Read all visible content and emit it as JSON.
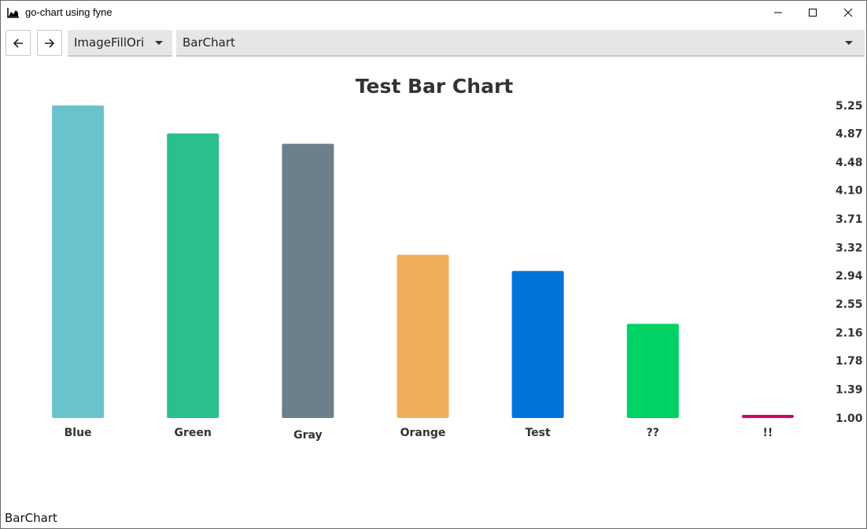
{
  "window": {
    "title": "go-chart using fyne",
    "icon": "area-chart-icon"
  },
  "toolbar": {
    "back_icon": "arrow-left-icon",
    "forward_icon": "arrow-right-icon",
    "option_select_value": "ImageFillOri",
    "chart_select_value": "BarChart"
  },
  "status_bar": {
    "text": "BarChart"
  },
  "chart_data": {
    "type": "bar",
    "title": "Test Bar Chart",
    "categories": [
      "Blue",
      "Green",
      "Gray",
      "Orange",
      "Test",
      "??",
      "!!"
    ],
    "values": [
      5.25,
      4.87,
      4.73,
      3.22,
      3.0,
      2.28,
      1.0
    ],
    "colors": [
      "#6ac3cb",
      "#2abf8b",
      "#6c7f8b",
      "#f0ae5b",
      "#0074d9",
      "#00d363",
      "#d30066"
    ],
    "y_ticks": [
      "1.00",
      "1.39",
      "1.78",
      "2.16",
      "2.55",
      "2.94",
      "3.32",
      "3.71",
      "4.10",
      "4.48",
      "4.87",
      "5.25"
    ],
    "ylim": [
      1.0,
      5.25
    ],
    "y_axis_position": "right",
    "grid": false,
    "xlabel": "",
    "ylabel": ""
  }
}
